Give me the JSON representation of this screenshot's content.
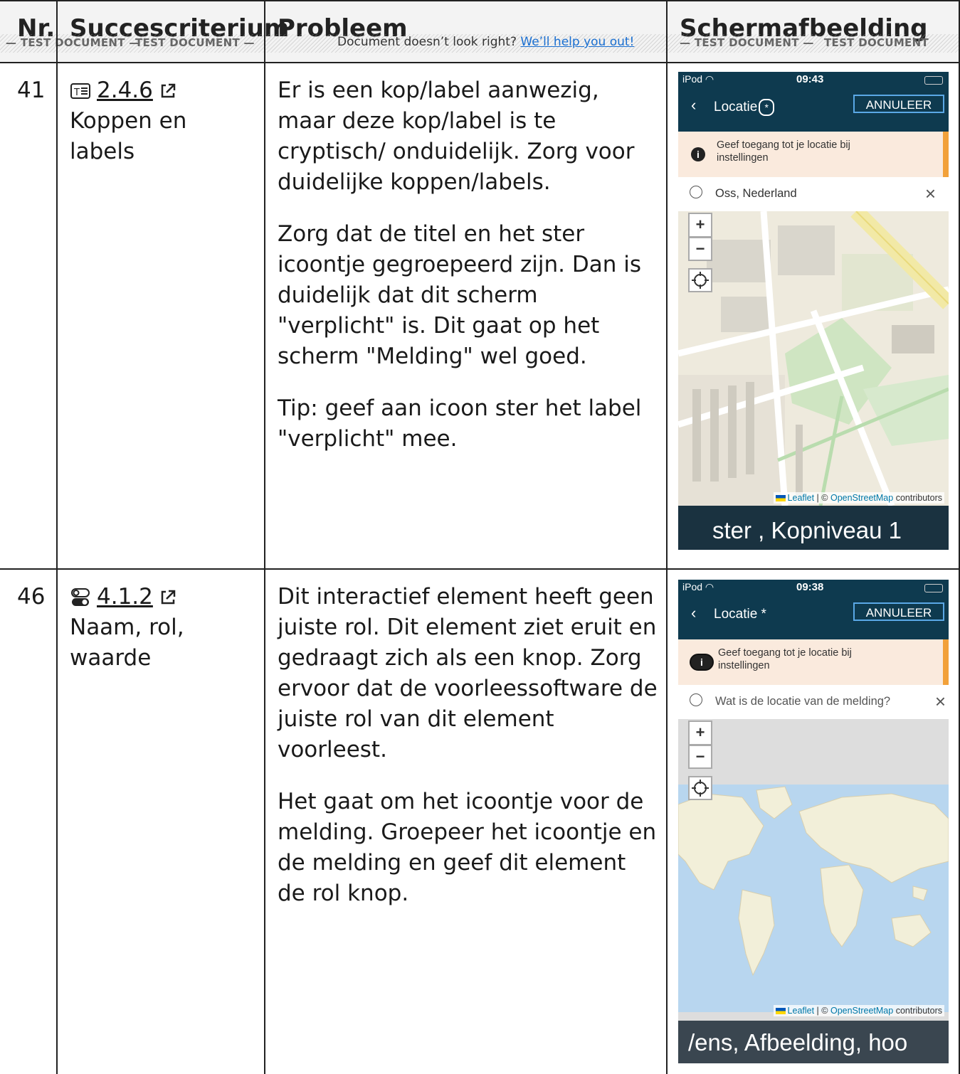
{
  "header": {
    "col_nr": "Nr.",
    "col_criterium": "Succescriterium",
    "col_probleem": "Probleem",
    "col_screenshot": "Schermafbeelding"
  },
  "banner": {
    "watermark": "TEST DOCUMENT",
    "message": "Document doesn’t look right?",
    "link": "We’ll help you out!"
  },
  "rows": [
    {
      "nr": "41",
      "criterion_code": "2.4.6",
      "criterion_name": "Koppen en labels",
      "criterion_icon": "heading-text-icon",
      "problem": [
        "Er is een kop/label aanwezig, maar deze kop/label is te cryptisch/ onduidelijk. Zorg voor duidelijke koppen/labels.",
        "Zorg dat de titel en het ster icoontje gegroepeerd zijn. Dan is duidelijk dat dit scherm \"verplicht\" is. Dit gaat op het scherm \"Melding\" wel goed.",
        "Tip: geef aan icoon ster het label \"verplicht\" mee."
      ],
      "phone": {
        "status_left": "iPod",
        "time": "09:43",
        "back": "‹",
        "title": "Locatie",
        "title_suffix": "*",
        "cancel": "ANNULEER",
        "notice": "Geef toegang tot je locatie bij instellingen",
        "search": "Oss, Nederland",
        "zoom_in": "+",
        "zoom_out": "−",
        "attribution_leaflet": "Leaflet",
        "attribution_sep": " | © ",
        "attribution_osm": "OpenStreetMap",
        "attribution_tail": " contributors",
        "voiceover": "ster , Kopniveau 1"
      }
    },
    {
      "nr": "46",
      "criterion_code": "4.1.2",
      "criterion_name": "Naam, rol, waarde",
      "criterion_icon": "toggle-switch-icon",
      "problem": [
        "Dit interactief element heeft geen juiste rol. Dit element ziet eruit en gedraagt zich als een knop. Zorg ervoor dat de voorleessoftware de juiste rol van dit element voorleest.",
        "Het gaat om het icoontje voor de melding. Groepeer het icoontje en de melding en geef dit element de rol knop."
      ],
      "phone": {
        "status_left": "iPod",
        "time": "09:38",
        "back": "‹",
        "title": "Locatie *",
        "cancel": "ANNULEER",
        "notice": "Geef toegang tot je locatie bij instellingen",
        "search": "Wat is de locatie van de melding?",
        "zoom_in": "+",
        "zoom_out": "−",
        "attribution_leaflet": "Leaflet",
        "attribution_sep": " | © ",
        "attribution_osm": "OpenStreetMap",
        "attribution_tail": " contributors",
        "voiceover": "/ens, Afbeelding, hoo"
      }
    }
  ],
  "colors": {
    "app_header": "#0e3a4f",
    "notice_bg": "#faeadd",
    "notice_accent": "#f2a13a",
    "link": "#1a6fd1",
    "map_water": "#b8d6ef",
    "map_land": "#f2efd9"
  }
}
